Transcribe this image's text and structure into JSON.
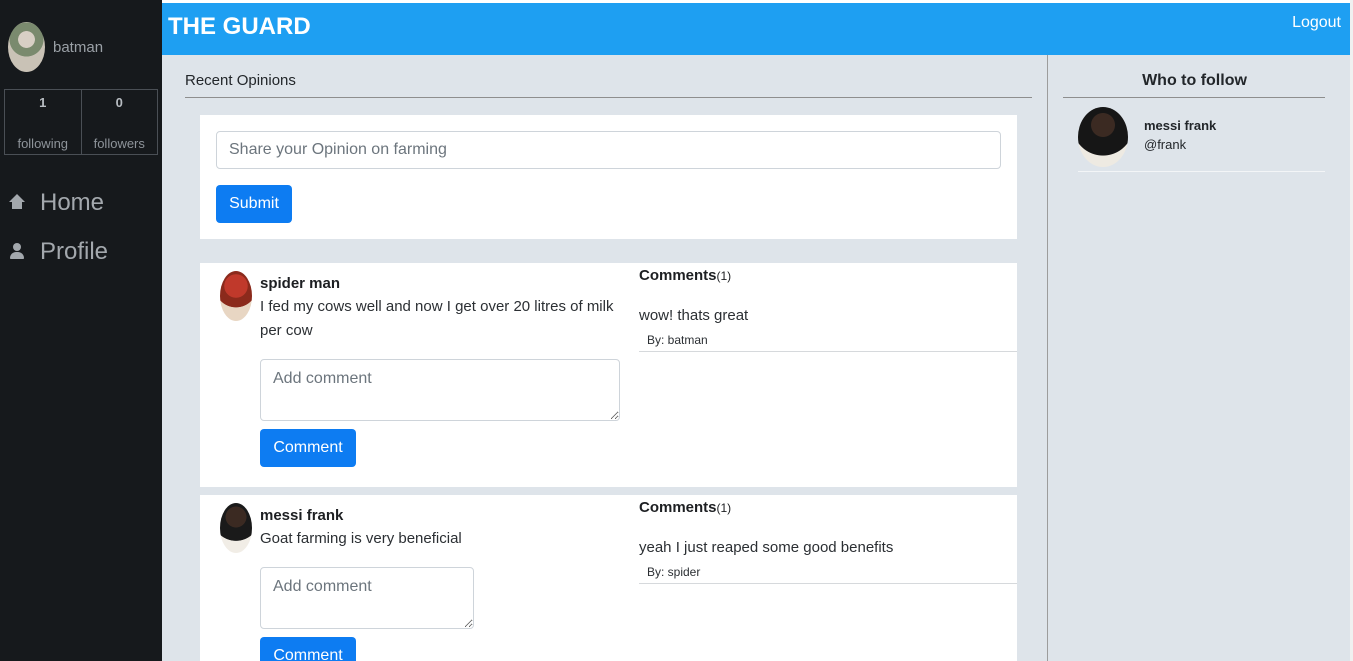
{
  "sidebar": {
    "username": "batman",
    "stats": [
      {
        "count": "1",
        "label": "following"
      },
      {
        "count": "0",
        "label": "followers"
      }
    ],
    "nav": [
      {
        "label": "Home",
        "icon": "home-icon"
      },
      {
        "label": "Profile",
        "icon": "user-icon"
      }
    ]
  },
  "header": {
    "brand": "THE GUARD",
    "logout": "Logout"
  },
  "main": {
    "title": "Recent Opinions",
    "compose_placeholder": "Share your Opinion on farming",
    "submit_label": "Submit",
    "posts": [
      {
        "author": "spider man",
        "text": "I fed my cows well and now I get over 20 litres of milk per cow",
        "comment_placeholder": "Add comment",
        "comment_button": "Comment",
        "comments_label": "Comments",
        "comments_count": "(1)",
        "comments": [
          {
            "text": "wow! thats great",
            "by": "By: batman"
          }
        ]
      },
      {
        "author": "messi frank",
        "text": "Goat farming is very beneficial",
        "comment_placeholder": "Add comment",
        "comment_button": "Comment",
        "comments_label": "Comments",
        "comments_count": "(1)",
        "comments": [
          {
            "text": "yeah I just reaped some good benefits",
            "by": "By: spider"
          }
        ]
      }
    ]
  },
  "right": {
    "title": "Who to follow",
    "suggestions": [
      {
        "name": "messi frank",
        "handle": "@frank"
      }
    ]
  },
  "colors": {
    "sidebar_bg": "#16191c",
    "topbar_bg": "#1e9ff2",
    "content_bg": "#dee4ea",
    "primary_button": "#0d7cf2"
  }
}
